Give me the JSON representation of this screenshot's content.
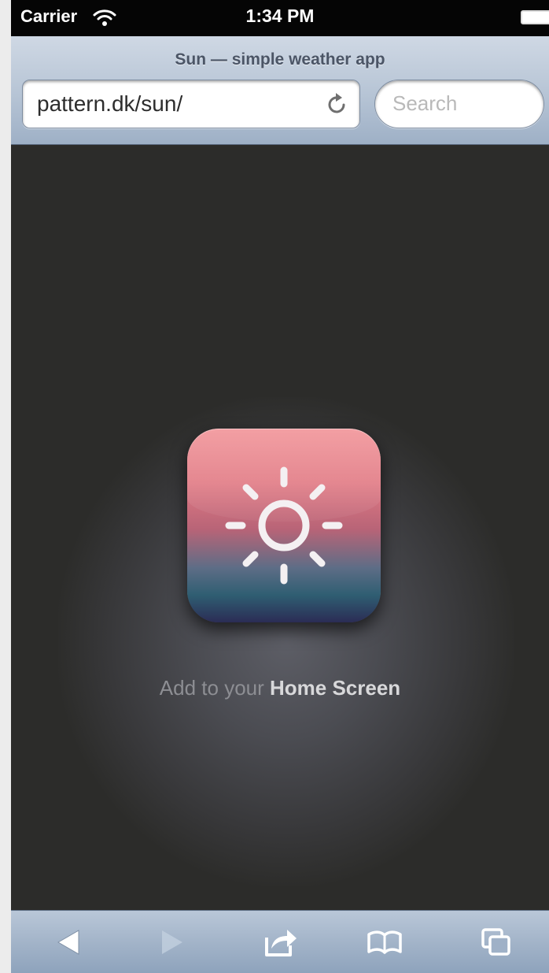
{
  "status_bar": {
    "carrier": "Carrier",
    "time": "1:34 PM",
    "icons": [
      "wifi-icon",
      "battery-icon"
    ]
  },
  "browser": {
    "page_title": "Sun — simple weather app",
    "url": "pattern.dk/sun/",
    "search_placeholder": "Search",
    "icons": [
      "reload-icon"
    ]
  },
  "content": {
    "app_icon": "sun-icon",
    "home_text_prefix": "Add to your ",
    "home_text_bold": "Home Screen"
  },
  "toolbar": {
    "buttons": [
      "back-icon",
      "forward-icon",
      "share-icon",
      "bookmarks-icon",
      "tabs-icon"
    ],
    "forward_enabled": false
  },
  "colors": {
    "background": "#2c2c2a",
    "chrome": "#b6c4d5",
    "icon_top": "#f08a8f",
    "icon_bottom": "#2b2c55"
  }
}
